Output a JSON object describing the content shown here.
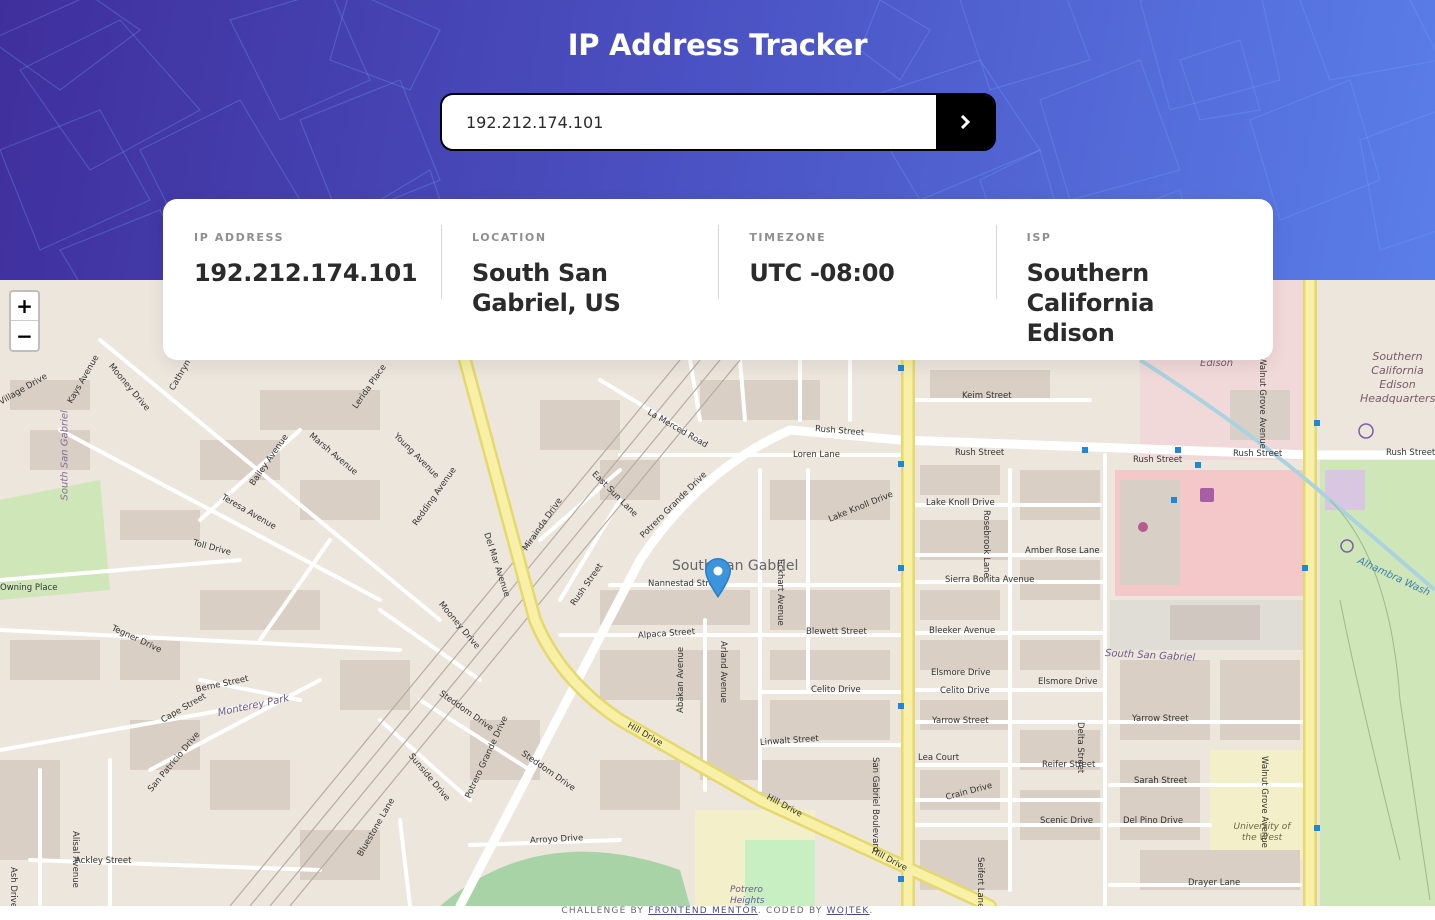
{
  "header": {
    "title": "IP Address Tracker",
    "background_colors": [
      "#3f2f9c",
      "#5a7ee8"
    ]
  },
  "search": {
    "value": "192.212.174.101",
    "button_icon": "chevron-right-icon"
  },
  "info": [
    {
      "label": "IP ADDRESS",
      "value": "192.212.174.101"
    },
    {
      "label": "LOCATION",
      "value": "South San Gabriel, US"
    },
    {
      "label": "TIMEZONE",
      "value": "UTC -08:00"
    },
    {
      "label": "ISP",
      "value": "Southern California Edison"
    }
  ],
  "map": {
    "zoom_in": "+",
    "zoom_out": "−",
    "place_name": "South San Gabriel",
    "marker_icon": "map-pin-icon",
    "streets": [
      "Rush Street",
      "Rush Street",
      "Rush Street",
      "Rush Street",
      "Rush Street",
      "Keim Street",
      "Lake Knoll Drive",
      "Lake Knoll Drive",
      "Amber Rose Lane",
      "Sierra Bonita Avenue",
      "Bleeker Avenue",
      "Blewett Street",
      "Alpaca Street",
      "Nannestad Street",
      "Celito Drive",
      "Celito Drive",
      "Elsmore Drive",
      "Elsmore Drive",
      "Yarrow Street",
      "Yarrow Street",
      "Linwalt Street",
      "Lea Court",
      "Reifer Street",
      "Sarah Street",
      "Crain Drive",
      "Scenic Drive",
      "Del Pino Drive",
      "Drayer Lane",
      "Hill Drive",
      "Hill Drive",
      "Hill Drive",
      "Del Mar Avenue",
      "San Gabriel Boulevard",
      "Walnut Grove Avenue",
      "Walnut Grove Avenue",
      "Delta Street",
      "Rosebrook Lane",
      "Eckhart Avenue",
      "Arland Avenue",
      "Abakan Avenue",
      "Potrero Grande Drive",
      "Potrero Grande Drive",
      "East Sun Lane",
      "La Merced Road",
      "Loren Lane",
      "Mirainda Drive",
      "Rush Street",
      "Mooney Drive",
      "Mooney Drive",
      "Redding Avenue",
      "Young Avenue",
      "Lerida Place",
      "Marsh Avenue",
      "Bailey Avenue",
      "Teresa Avenue",
      "Toll Drive",
      "Tegner Drive",
      "Berne Street",
      "Cape Street",
      "San Patricio Drive",
      "Alisal Avenue",
      "Ackley Street",
      "Ash Drive",
      "Bluestone Lane",
      "Steddom Drive",
      "Steddom Drive",
      "Sunside Drive",
      "Arroyo Drive",
      "Kays Avenue",
      "Village Drive",
      "Cathryn Drive",
      "Seifert Lane",
      "Owning Place",
      "Alhambra Wash",
      "Edison"
    ],
    "areas": [
      "Monterey Park",
      "South San Gabriel",
      "Southern California Edison Headquarters",
      "University of the West",
      "South San Gabriel",
      "Potrero Heights"
    ]
  },
  "footer": {
    "prefix": "CHALLENGE BY",
    "author1": "FRONTEND MENTOR",
    "middle": ". CODED BY",
    "author2": "WOJTEK",
    "suffix": "."
  }
}
